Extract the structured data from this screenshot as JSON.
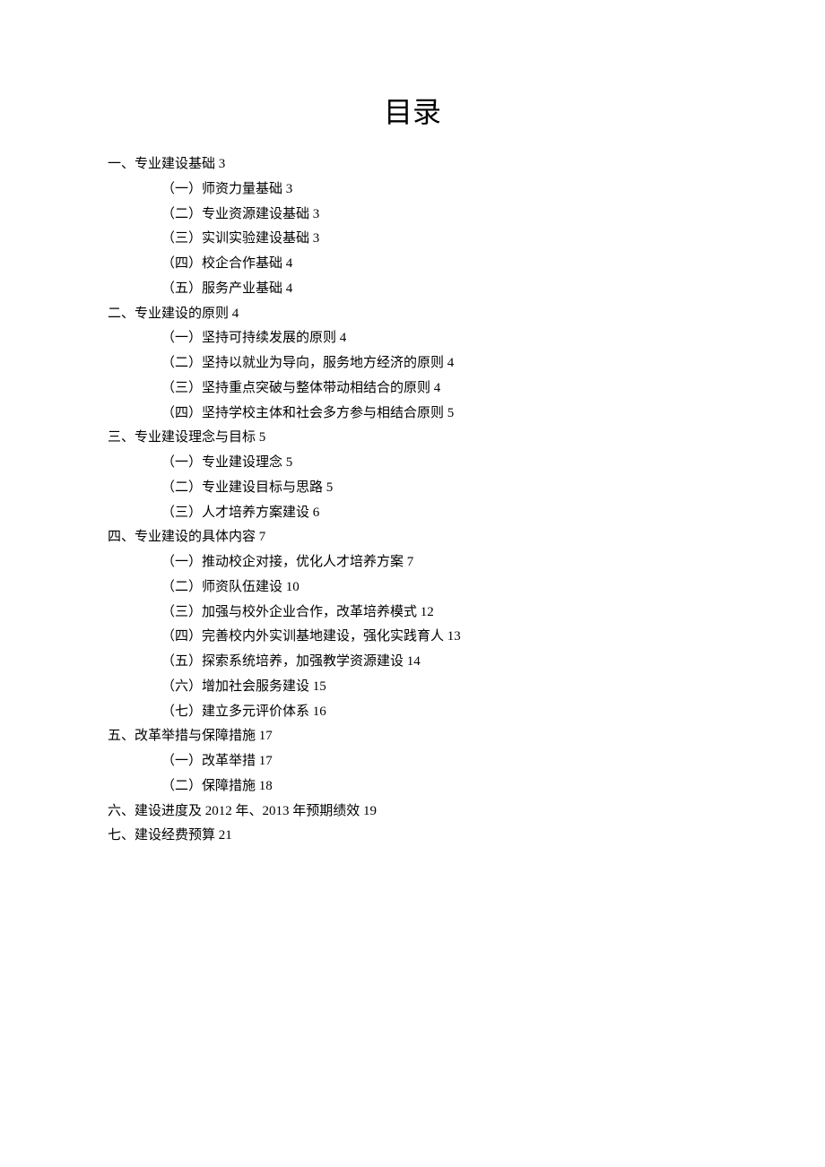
{
  "title": "目录",
  "toc": [
    {
      "level": 1,
      "text": "一、专业建设基础",
      "page": "3"
    },
    {
      "level": 2,
      "text": "（一）师资力量基础",
      "page": "3"
    },
    {
      "level": 2,
      "text": "（二）专业资源建设基础",
      "page": "3"
    },
    {
      "level": 2,
      "text": "（三）实训实验建设基础",
      "page": "3"
    },
    {
      "level": 2,
      "text": "（四）校企合作基础",
      "page": "4"
    },
    {
      "level": 2,
      "text": "（五）服务产业基础",
      "page": "4"
    },
    {
      "level": 1,
      "text": "二、专业建设的原则",
      "page": "4"
    },
    {
      "level": 2,
      "text": "（一）坚持可持续发展的原则",
      "page": "4"
    },
    {
      "level": 2,
      "text": "（二）坚持以就业为导向，服务地方经济的原则",
      "page": "4"
    },
    {
      "level": 2,
      "text": "（三）坚持重点突破与整体带动相结合的原则",
      "page": "4"
    },
    {
      "level": 2,
      "text": "（四）坚持学校主体和社会多方参与相结合原则",
      "page": "5"
    },
    {
      "level": 1,
      "text": "三、专业建设理念与目标",
      "page": "5"
    },
    {
      "level": 2,
      "text": "（一）专业建设理念",
      "page": "5"
    },
    {
      "level": 2,
      "text": "（二）专业建设目标与思路",
      "page": "5"
    },
    {
      "level": 2,
      "text": "（三）人才培养方案建设",
      "page": "6"
    },
    {
      "level": 1,
      "text": "四、专业建设的具体内容",
      "page": "7"
    },
    {
      "level": 2,
      "text": "（一）推动校企对接，优化人才培养方案",
      "page": "7"
    },
    {
      "level": 2,
      "text": "（二）师资队伍建设",
      "page": "10"
    },
    {
      "level": 2,
      "text": "（三）加强与校外企业合作，改革培养模式",
      "page": "12"
    },
    {
      "level": 2,
      "text": "（四）完善校内外实训基地建设，强化实践育人",
      "page": "13"
    },
    {
      "level": 2,
      "text": "（五）探索系统培养，加强教学资源建设",
      "page": "14"
    },
    {
      "level": 2,
      "text": "（六）增加社会服务建设",
      "page": "15"
    },
    {
      "level": 2,
      "text": "（七）建立多元评价体系",
      "page": "16"
    },
    {
      "level": 1,
      "text": "五、改革举措与保障措施",
      "page": "17"
    },
    {
      "level": 2,
      "text": "（一）改革举措",
      "page": "17"
    },
    {
      "level": 2,
      "text": "（二）保障措施",
      "page": "18"
    },
    {
      "level": 1,
      "text": "六、建设进度及 2012 年、2013 年预期绩效",
      "page": "19"
    },
    {
      "level": 1,
      "text": "七、建设经费预算",
      "page": "21"
    }
  ]
}
